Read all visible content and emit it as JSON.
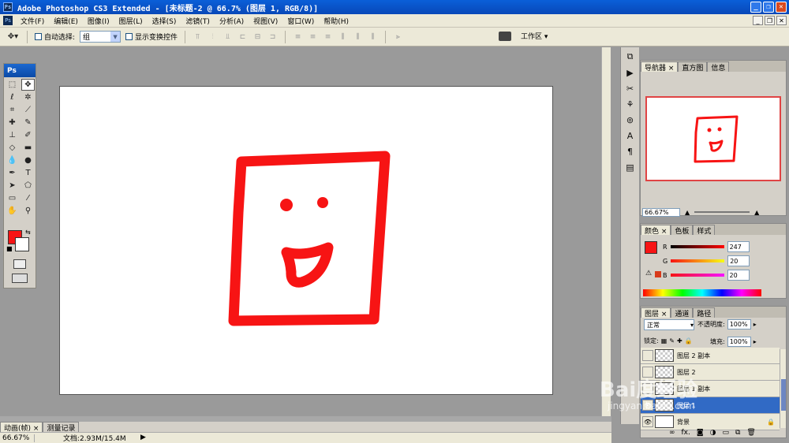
{
  "titlebar": {
    "logo": "Ps",
    "title": "Adobe Photoshop CS3 Extended - [未标题-2 @ 66.7% (图层 1, RGB/8)]"
  },
  "menubar": {
    "items": [
      {
        "label": "文件(F)"
      },
      {
        "label": "编辑(E)"
      },
      {
        "label": "图像(I)"
      },
      {
        "label": "图层(L)"
      },
      {
        "label": "选择(S)"
      },
      {
        "label": "滤镜(T)"
      },
      {
        "label": "分析(A)"
      },
      {
        "label": "视图(V)"
      },
      {
        "label": "窗口(W)"
      },
      {
        "label": "帮助(H)"
      }
    ]
  },
  "options": {
    "auto_select_label": "自动选择:",
    "auto_select_value": "组",
    "show_transform_label": "显示变换控件",
    "workspace_label": "工作区 ▾"
  },
  "toolbox": {
    "title": "Ps",
    "foreground_color": "#f71414",
    "background_color": "#ffffff"
  },
  "navigator": {
    "tabs": [
      {
        "label": "导航器 ×"
      },
      {
        "label": "直方图"
      },
      {
        "label": "信息"
      }
    ],
    "zoom": "66.67%"
  },
  "color": {
    "tabs": [
      {
        "label": "颜色 ×"
      },
      {
        "label": "色板"
      },
      {
        "label": "样式"
      }
    ],
    "r_label": "R",
    "g_label": "G",
    "b_label": "B",
    "r": "247",
    "g": "20",
    "b": "20",
    "swatch": "#f71414"
  },
  "layers": {
    "tabs": [
      {
        "label": "图层 ×"
      },
      {
        "label": "通道"
      },
      {
        "label": "路径"
      }
    ],
    "blend_mode": "正常",
    "opacity_label": "不透明度:",
    "opacity": "100%",
    "lock_label": "锁定:",
    "fill_label": "填充:",
    "fill": "100%",
    "rows": [
      {
        "name": "图层 2 副本"
      },
      {
        "name": "图层 2"
      },
      {
        "name": "图层 1 副本"
      },
      {
        "name": "图层 1"
      },
      {
        "name": "背景"
      }
    ]
  },
  "bottom": {
    "anim_tab": "动画(帧) ×",
    "measure_tab": "测量记录",
    "zoom": "66.67%",
    "doc_info": "文档:2.93M/15.4M"
  },
  "watermark": {
    "main": "Bai度经验",
    "sub": "jingyan.baidu.com"
  }
}
